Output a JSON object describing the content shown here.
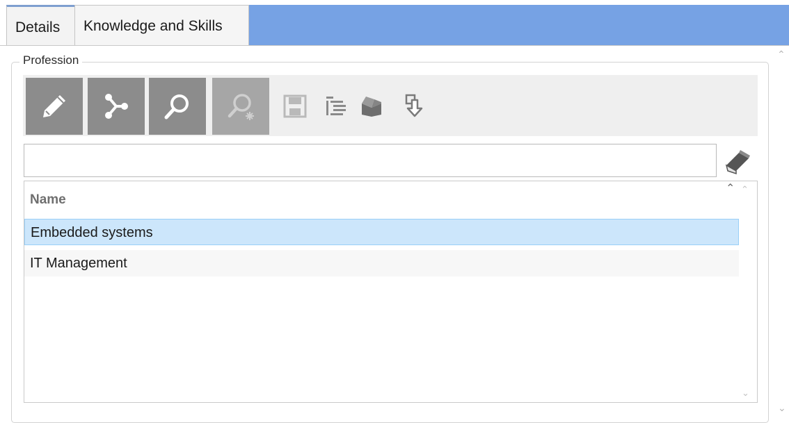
{
  "tabs": [
    {
      "label": "Details",
      "selected": true
    },
    {
      "label": "Knowledge and Skills",
      "selected": false
    }
  ],
  "group": {
    "label": "Profession"
  },
  "toolbar": {
    "buttons": [
      {
        "icon": "pencil-icon",
        "enabled": true
      },
      {
        "icon": "hierarchy-icon",
        "enabled": true
      },
      {
        "icon": "search-icon",
        "enabled": true
      },
      {
        "icon": "advanced-search-icon",
        "enabled": false
      }
    ],
    "small_icons": [
      "save-icon",
      "indent-list-icon",
      "export-icon",
      "import-icon"
    ]
  },
  "search": {
    "value": "",
    "placeholder": ""
  },
  "list": {
    "column_header": "Name",
    "rows": [
      {
        "name": "Embedded systems",
        "selected": true
      },
      {
        "name": "IT Management",
        "selected": false
      }
    ]
  },
  "colors": {
    "tab_strip": "#76a2e4",
    "toolbar_button": "#8c8c8c",
    "selected_row": "#cce6fb",
    "selected_row_border": "#99cff8"
  }
}
